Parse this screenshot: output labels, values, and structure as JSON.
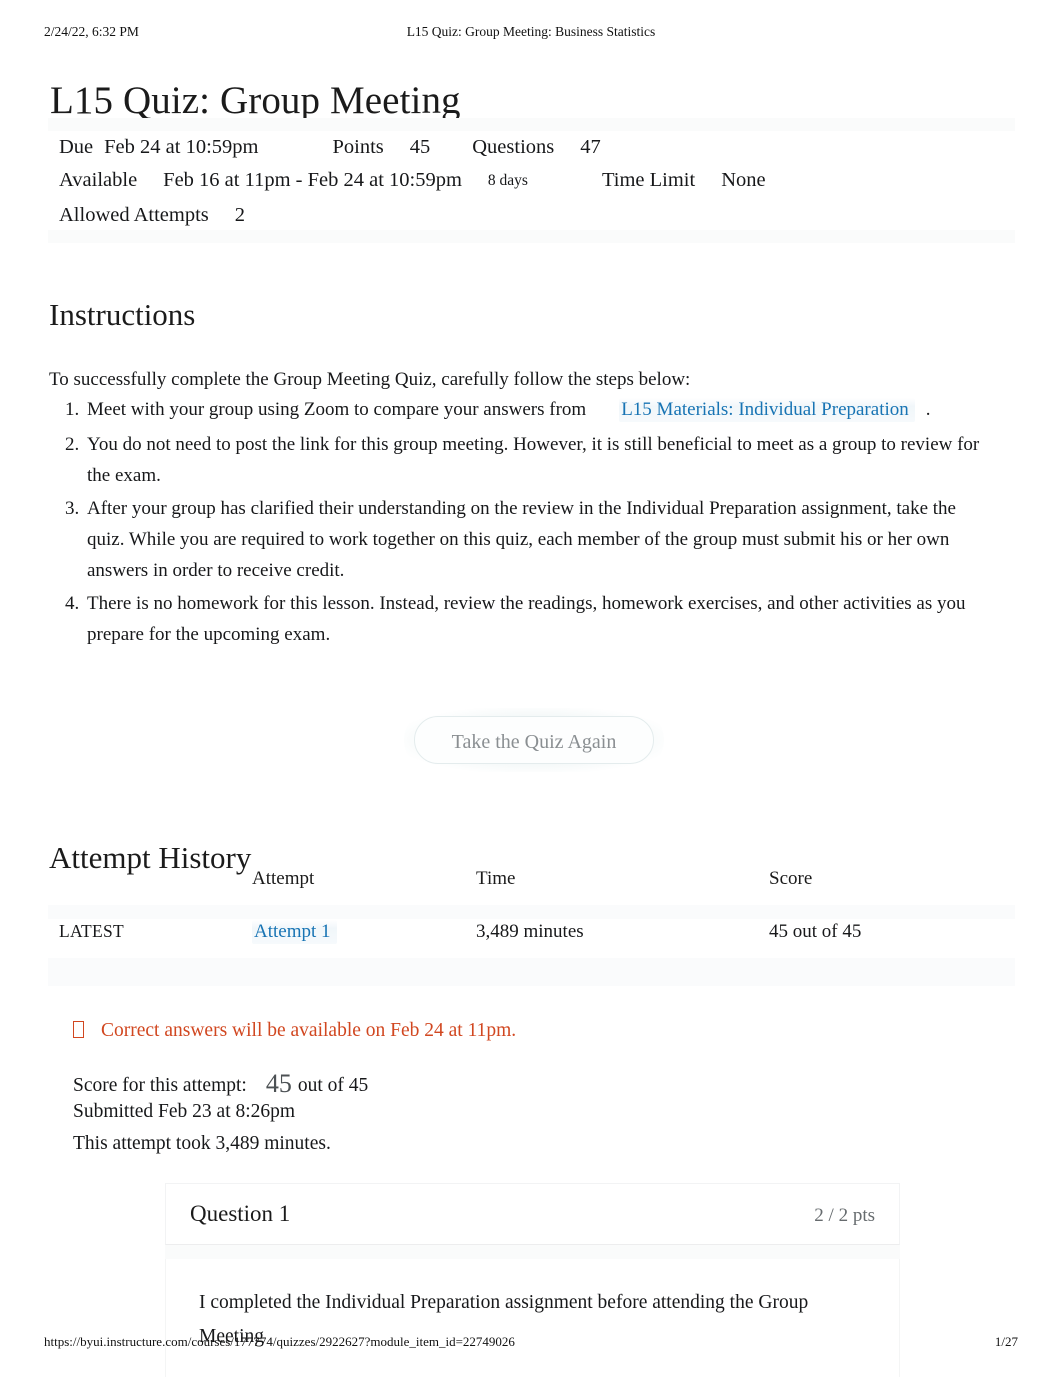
{
  "print_header": {
    "date": "2/24/22, 6:32 PM",
    "title": "L15 Quiz: Group Meeting: Business Statistics"
  },
  "page_title": "L15 Quiz: Group Meeting",
  "quiz_meta": {
    "due_label": "Due",
    "due_value": "Feb 24 at 10:59pm",
    "points_label": "Points",
    "points_value": "45",
    "questions_label": "Questions",
    "questions_value": "47",
    "available_label": "Available",
    "available_value": "Feb 16 at 11pm - Feb 24 at 10:59pm",
    "available_duration": "8 days",
    "time_limit_label": "Time Limit",
    "time_limit_value": "None",
    "allowed_attempts_label": "Allowed Attempts",
    "allowed_attempts_value": "2"
  },
  "instructions": {
    "heading": "Instructions",
    "intro": "To successfully complete the Group Meeting Quiz, carefully follow the steps below:",
    "step1_before": "Meet with your group using Zoom to compare your answers from",
    "step1_link": "L15 Materials: Individual Preparation",
    "step1_after": ".",
    "step2": "You do not need to post the link for this group meeting. However, it is still beneficial to meet as a group to review for the exam.",
    "step3": "After your group has clarified their understanding on the review in the Individual Preparation assignment, take the quiz. While you are required to work together on this quiz, each member of the group must submit his or her own answers in order to receive credit.",
    "step4": "There is no homework for this lesson. Instead, review the readings, homework exercises, and other activities as you prepare for the upcoming exam."
  },
  "retake_button": {
    "label": "Take the Quiz Again"
  },
  "attempt_history": {
    "heading": "Attempt History",
    "columns": [
      "",
      "Attempt",
      "Time",
      "Score"
    ],
    "rows": [
      {
        "latest": "LATEST",
        "attempt": "Attempt 1",
        "time": "3,489 minutes",
        "score": "45 out of 45"
      }
    ]
  },
  "notice": {
    "text": "Correct answers will be available on Feb 24 at 11pm.",
    "color": "#d14720"
  },
  "score_summary": {
    "score_label": "Score for this attempt:",
    "score_value": "45",
    "score_out_of": "out of 45",
    "submitted": "Submitted Feb 23 at 8:26pm",
    "duration": "This attempt took 3,489 minutes."
  },
  "question": {
    "title": "Question 1",
    "points": "2 / 2 pts",
    "text": "I completed the Individual Preparation assignment before attending the Group Meeting"
  },
  "print_footer": {
    "url": "https://byui.instructure.com/courses/177774/quizzes/2922627?module_item_id=22749026",
    "page": "1/27"
  },
  "colors": {
    "link": "#1874b4",
    "notice": "#d14720",
    "text": "#17181a"
  }
}
